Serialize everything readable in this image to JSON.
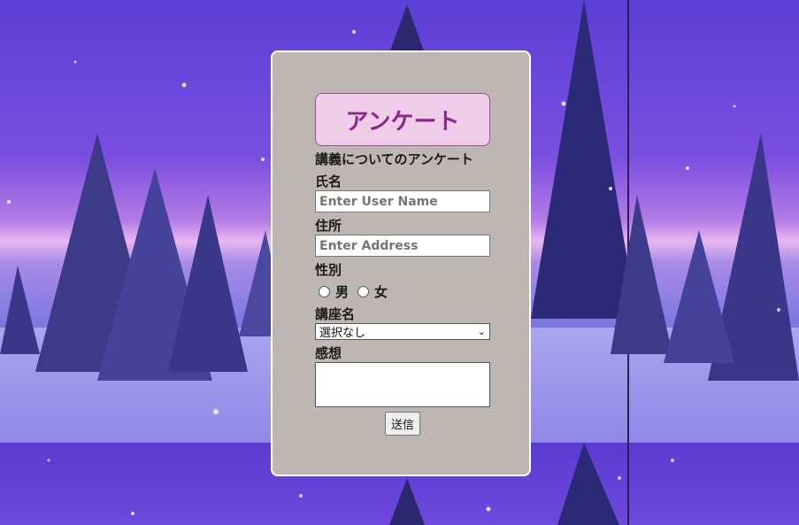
{
  "survey": {
    "heading": "アンケート",
    "subtitle": "講義についてのアンケート",
    "name_label": "氏名",
    "name_placeholder": "Enter User Name",
    "address_label": "住所",
    "address_placeholder": "Enter Address",
    "gender_label": "性別",
    "gender_options": [
      "男",
      "女"
    ],
    "course_label": "講座名",
    "course_selected": "選択なし",
    "impression_label": "感想",
    "submit_label": "送信"
  },
  "colors": {
    "card_bg": "#bdb6b3",
    "title_bg": "#efcde8",
    "title_text": "#8a2a8e"
  }
}
